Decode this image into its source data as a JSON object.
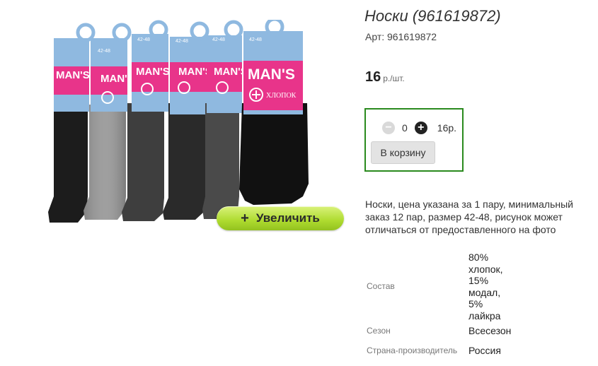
{
  "product": {
    "title": "Носки (961619872)",
    "sku": "Арт: 961619872",
    "price": "16",
    "price_unit": "р./шт.",
    "image": {
      "brand_text": "MAN'S",
      "label_text": "ХЛОПОК",
      "size_text": "42-48"
    }
  },
  "zoom_button": {
    "plus": "+",
    "label": "Увеличить"
  },
  "cart": {
    "minus": "−",
    "plus": "+",
    "quantity": "0",
    "total": "16р.",
    "add_label": "В корзину"
  },
  "description": "Носки, цена указана за 1 пару, минимальный заказ 12 пар, размер 42-48, рисунок может отличаться от предоставленного на фото",
  "properties": [
    {
      "name": "Состав",
      "value_lines": [
        "80%",
        "хлопок,",
        "15%",
        "модал,",
        "5%",
        "лайкра"
      ]
    },
    {
      "name": "Сезон",
      "value": "Всесезон"
    },
    {
      "name": "Страна-производитель",
      "value": "Россия"
    }
  ],
  "colors": {
    "cart_border": "#2a8a1e",
    "zoom_button": "#aedb2f",
    "label_pink": "#e8348a",
    "label_blue": "#8fb9e0"
  }
}
